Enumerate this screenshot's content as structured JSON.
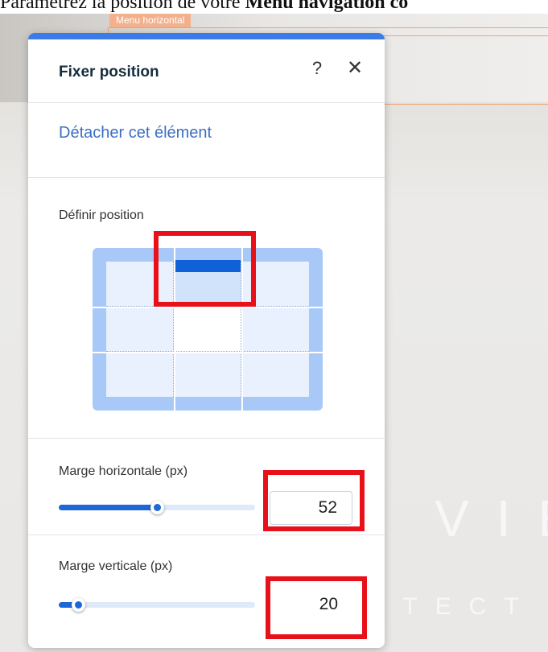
{
  "caption": {
    "prefix": "Paramétrez la position de votre ",
    "bold": "Menu navigation co"
  },
  "canvas": {
    "menu_tag": "Menu horizontal",
    "ghost_big": "VIE",
    "ghost_small": "ITECT"
  },
  "panel": {
    "title": "Fixer position",
    "help_icon": "?",
    "close_icon": "✕",
    "detach_label": "Détacher cet élément",
    "position_label": "Définir position",
    "selected_position": "top-center",
    "horizontal": {
      "label": "Marge horizontale (px)",
      "value": "52",
      "slider_fraction": 0.5
    },
    "vertical": {
      "label": "Marge verticale (px)",
      "value": "20",
      "slider_fraction": 0.1
    }
  },
  "colors": {
    "accent": "#1e67d8",
    "topbar": "#3b7be8",
    "link": "#3b6fc2",
    "highlight": "#e8111a"
  }
}
